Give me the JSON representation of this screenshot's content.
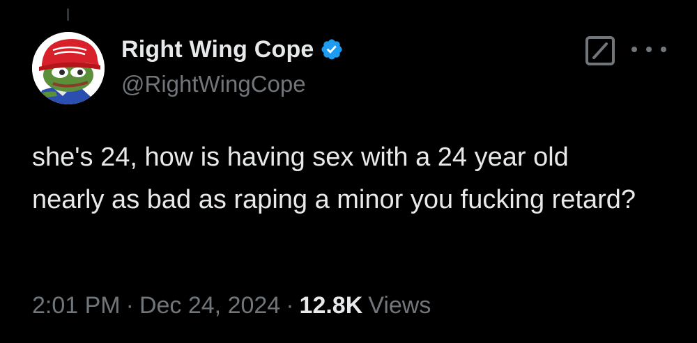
{
  "author": {
    "display_name": "Right Wing Cope",
    "handle": "@RightWingCope",
    "verified": true,
    "verified_color": "#1d9bf0",
    "avatar_icon": "pepe-frog-maga-hat-avatar",
    "avatar_hat_text": "MAKE AMERICA GREAT AGAIN"
  },
  "tweet": {
    "text": "she's 24, how is having sex with a 24 year old nearly as bad as raping a minor you fucking retard?"
  },
  "meta": {
    "time": "2:01 PM",
    "separator": "·",
    "date": "Dec 24, 2024",
    "views_count": "12.8K",
    "views_label": "Views"
  },
  "actions": {
    "grok_icon": "grok-icon",
    "more_icon": "more-horizontal-icon"
  },
  "colors": {
    "background": "#000000",
    "primary_text": "#e7e9ea",
    "secondary_text": "#71767b",
    "accent": "#1d9bf0"
  }
}
